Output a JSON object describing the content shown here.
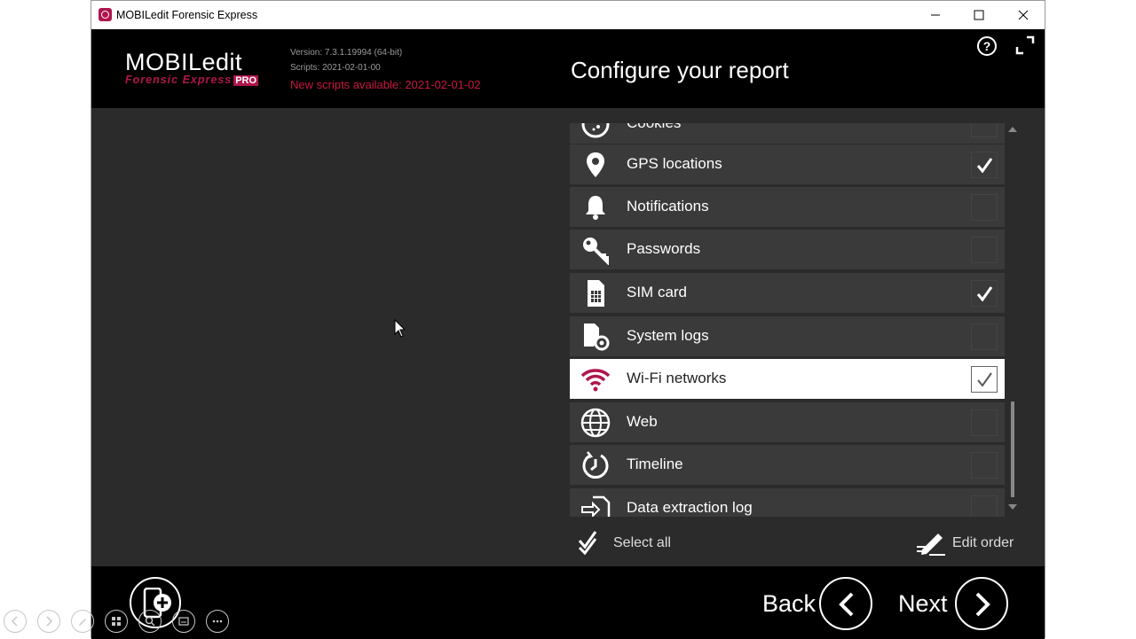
{
  "window": {
    "title": "MOBILedit Forensic Express",
    "controls": [
      "minimize-icon",
      "maximize-icon",
      "close-icon"
    ]
  },
  "header": {
    "logo_main": "MOBILedit",
    "logo_sub": "Forensic Express",
    "logo_badge": "PRO",
    "version": "Version: 7.3.1.19994 (64-bit)",
    "scripts": "Scripts: 2021-02-01-00",
    "new_scripts": "New scripts available: 2021-02-01-02",
    "page_title": "Configure your report",
    "help_label": "?"
  },
  "list": {
    "items": [
      {
        "label": "Cookies",
        "icon": "cookie-icon",
        "checked": false,
        "selected": false
      },
      {
        "label": "GPS locations",
        "icon": "location-pin-icon",
        "checked": true,
        "selected": false
      },
      {
        "label": "Notifications",
        "icon": "bell-icon",
        "checked": false,
        "selected": false
      },
      {
        "label": "Passwords",
        "icon": "key-icon",
        "checked": false,
        "selected": false
      },
      {
        "label": "SIM card",
        "icon": "sim-card-icon",
        "checked": true,
        "selected": false
      },
      {
        "label": "System logs",
        "icon": "system-logs-icon",
        "checked": false,
        "selected": false
      },
      {
        "label": "Wi-Fi networks",
        "icon": "wifi-icon",
        "checked": true,
        "selected": true
      },
      {
        "label": "Web",
        "icon": "globe-icon",
        "checked": false,
        "selected": false
      },
      {
        "label": "Timeline",
        "icon": "timeline-icon",
        "checked": false,
        "selected": false
      },
      {
        "label": "Data extraction log",
        "icon": "extraction-log-icon",
        "checked": false,
        "selected": false
      }
    ]
  },
  "actions": {
    "select_all": "Select all",
    "edit_order": "Edit order"
  },
  "footer": {
    "back": "Back",
    "next": "Next"
  },
  "colors": {
    "accent": "#b0154e",
    "warning_text": "#c9173f",
    "panel_bg": "#2b2b2b",
    "row_bg": "#3a3a3a",
    "header_bg": "#000000"
  }
}
